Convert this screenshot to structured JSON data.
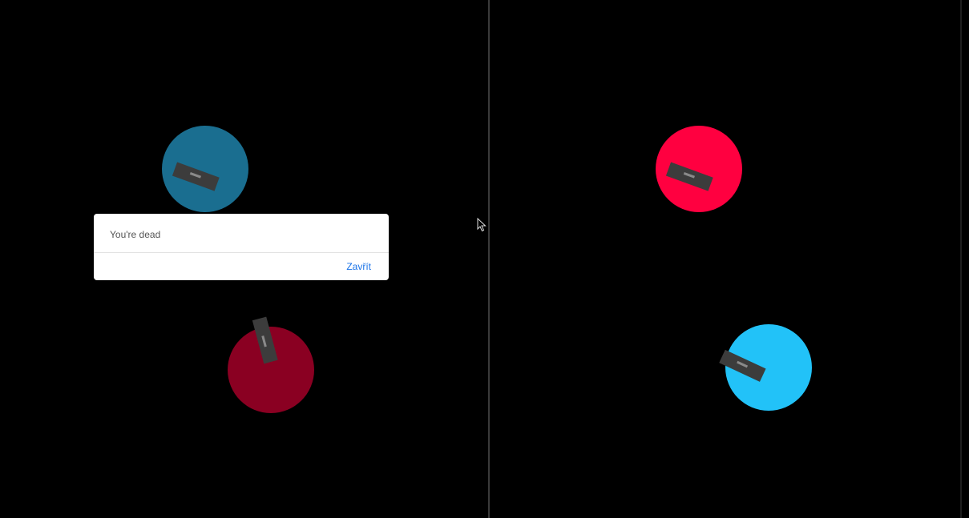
{
  "players": {
    "left_view": {
      "tanks": [
        {
          "id": "own",
          "color": "#1a6e90"
        },
        {
          "id": "enemy",
          "color": "#8a0022"
        }
      ]
    },
    "right_view": {
      "tanks": [
        {
          "id": "own",
          "color": "#ff0040"
        },
        {
          "id": "enemy",
          "color": "#22c2f8"
        }
      ]
    }
  },
  "dialog": {
    "message": "You're dead",
    "close_label": "Zavřít",
    "accent_color": "#1a73e8"
  },
  "cursor": {
    "icon": "mouse-pointer-icon"
  }
}
